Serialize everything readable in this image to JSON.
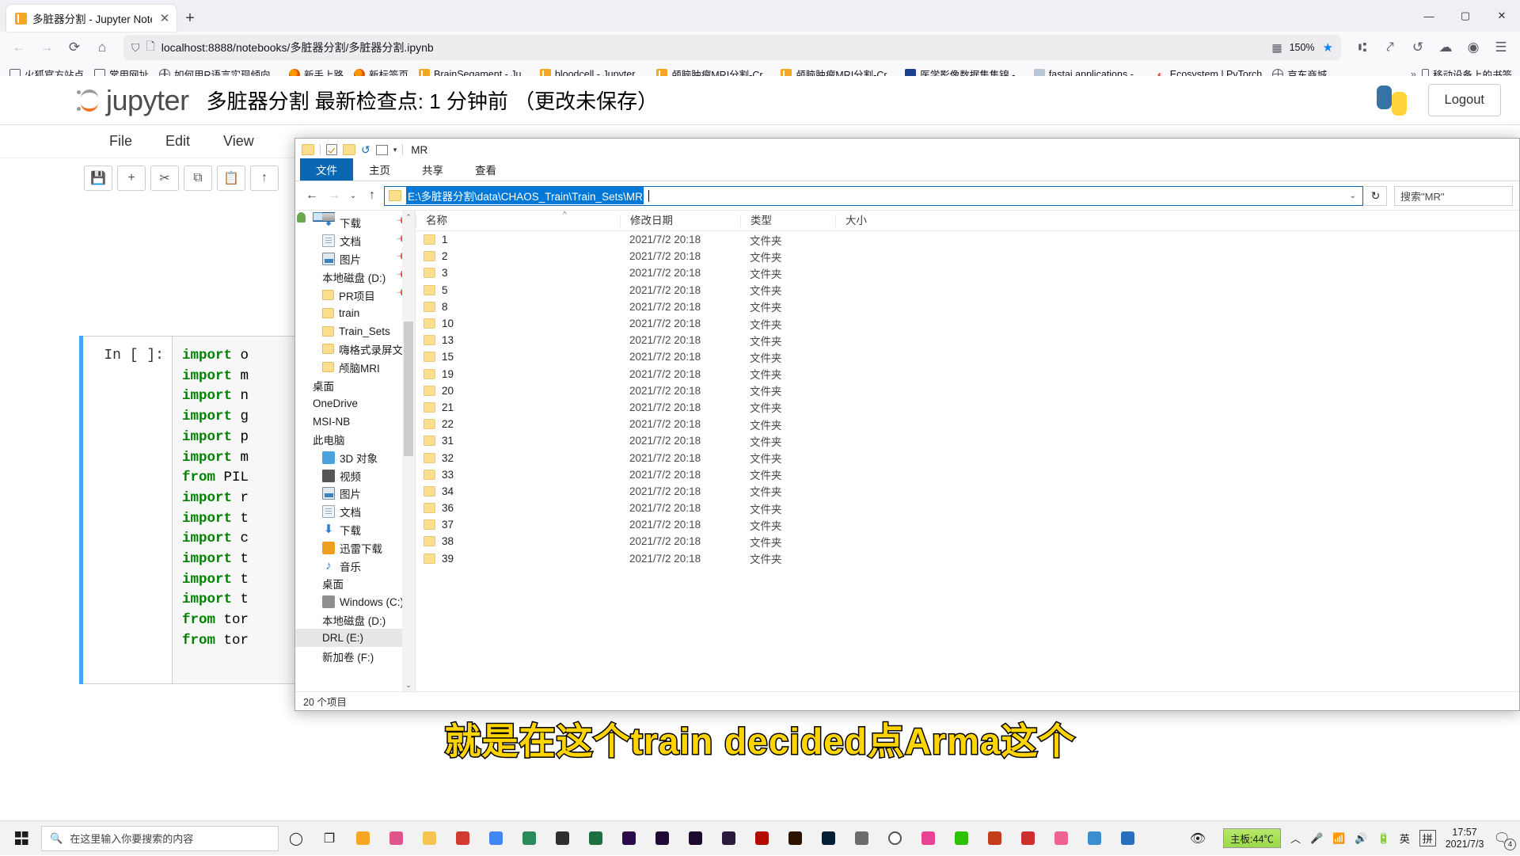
{
  "browser": {
    "tab": {
      "title": "多脏器分割 - Jupyter Notebo",
      "close": "✕",
      "favicon": "jupyter-book-icon"
    },
    "newtab_label": "+",
    "window_controls": {
      "minimize": "—",
      "maximize": "▢",
      "close": "✕"
    },
    "nav": {
      "back": "←",
      "forward": "→",
      "reload": "⟳",
      "home": "⌂"
    },
    "url": "localhost:8888/notebooks/多脏器分割/多脏器分割.ipynb",
    "zoom": "150%",
    "bookmarks": [
      {
        "label": "火狐官方站点",
        "icon": "folder-icon"
      },
      {
        "label": "常用网址",
        "icon": "folder-icon"
      },
      {
        "label": "如何用R语言实现倾向...",
        "icon": "globe-icon"
      },
      {
        "label": "新手上路",
        "icon": "firefox-icon"
      },
      {
        "label": "新标签页",
        "icon": "firefox-icon"
      },
      {
        "label": "BrainSegament - Ju...",
        "icon": "jupyter-icon"
      },
      {
        "label": "bloodcell - Jupyter ...",
        "icon": "jupyter-icon"
      },
      {
        "label": "颅脑肿瘤MRI分割-Cr...",
        "icon": "jupyter-icon"
      },
      {
        "label": "颅脑肿瘤MRI分割-Cr...",
        "icon": "jupyter-icon"
      },
      {
        "label": "医学影像数据集集锦 -...",
        "icon": "blue-square-icon"
      },
      {
        "label": "fastai applications - ...",
        "icon": "fastai-icon"
      },
      {
        "label": "Ecosystem | PyTorch",
        "icon": "pytorch-icon"
      },
      {
        "label": "京东商城",
        "icon": "globe-icon"
      }
    ],
    "bookmarks_overflow": "»",
    "mobile_bookmarks": "移动设备上的书签"
  },
  "jupyter": {
    "logo_text": "jupyter",
    "title": "多脏器分割 最新检查点: 1 分钟前 （更改未保存）",
    "logout_label": "Logout",
    "menus": [
      "File",
      "Edit",
      "View"
    ],
    "toolbar_icons": [
      "save-icon",
      "add-cell-icon",
      "cut-icon",
      "copy-icon",
      "paste-icon",
      "move-up-icon"
    ],
    "cell": {
      "prompt": "In [ ]:",
      "code_lines": [
        {
          "kw": "import",
          "rest": " o"
        },
        {
          "kw": "import",
          "rest": " m"
        },
        {
          "kw": "import",
          "rest": " n"
        },
        {
          "kw": "import",
          "rest": " g"
        },
        {
          "kw": "import",
          "rest": " p"
        },
        {
          "kw": "import",
          "rest": " m"
        },
        {
          "kw": "from",
          "rest": " PIL"
        },
        {
          "kw": "import",
          "rest": " r"
        },
        {
          "kw": "import",
          "rest": " t"
        },
        {
          "kw": "import",
          "rest": " c"
        },
        {
          "kw": "import",
          "rest": " t"
        },
        {
          "kw": "import",
          "rest": " t"
        },
        {
          "kw": "import",
          "rest": " t"
        },
        {
          "kw": "from",
          "rest": " tor"
        },
        {
          "kw": "from",
          "rest": " tor"
        }
      ]
    }
  },
  "explorer": {
    "quick_access_title": "MR",
    "ribbon_tabs": [
      "文件",
      "主页",
      "共享",
      "查看"
    ],
    "ribbon_active_index": 0,
    "address": "E:\\多脏器分割\\data\\CHAOS_Train\\Train_Sets\\MR",
    "address_dropdown": "⌄",
    "refresh": "↻",
    "search_placeholder": "搜索\"MR\"",
    "nav_items": [
      {
        "label": "下载",
        "icon": "download-icon",
        "pinned": true,
        "indent": 1
      },
      {
        "label": "文档",
        "icon": "documents-icon",
        "pinned": true,
        "indent": 1
      },
      {
        "label": "图片",
        "icon": "pictures-icon",
        "pinned": true,
        "indent": 1
      },
      {
        "label": "本地磁盘 (D:)",
        "icon": "disk-icon",
        "pinned": true,
        "indent": 1
      },
      {
        "label": "PR项目",
        "icon": "folder-icon",
        "pinned": true,
        "indent": 1
      },
      {
        "label": "train",
        "icon": "folder-icon",
        "pinned": false,
        "indent": 1
      },
      {
        "label": "Train_Sets",
        "icon": "folder-icon",
        "pinned": false,
        "indent": 1
      },
      {
        "label": "嗨格式录屏文件",
        "icon": "folder-icon",
        "pinned": false,
        "indent": 1
      },
      {
        "label": "颅脑MRI",
        "icon": "folder-icon",
        "pinned": false,
        "indent": 1
      },
      {
        "label": "桌面",
        "icon": "desktop-icon",
        "pinned": false,
        "indent": 0
      },
      {
        "label": "OneDrive",
        "icon": "onedrive-icon",
        "pinned": false,
        "indent": 0
      },
      {
        "label": "MSI-NB",
        "icon": "user-icon",
        "pinned": false,
        "indent": 0
      },
      {
        "label": "此电脑",
        "icon": "this-pc-icon",
        "pinned": false,
        "indent": 0
      },
      {
        "label": "3D 对象",
        "icon": "3d-objects-icon",
        "pinned": false,
        "indent": 1
      },
      {
        "label": "视频",
        "icon": "videos-icon",
        "pinned": false,
        "indent": 1
      },
      {
        "label": "图片",
        "icon": "pictures-icon",
        "pinned": false,
        "indent": 1
      },
      {
        "label": "文档",
        "icon": "documents-icon",
        "pinned": false,
        "indent": 1
      },
      {
        "label": "下载",
        "icon": "download-icon",
        "pinned": false,
        "indent": 1
      },
      {
        "label": "迅雷下载",
        "icon": "thunder-icon",
        "pinned": false,
        "indent": 1
      },
      {
        "label": "音乐",
        "icon": "music-icon",
        "pinned": false,
        "indent": 1
      },
      {
        "label": "桌面",
        "icon": "desktop-icon",
        "pinned": false,
        "indent": 1
      },
      {
        "label": "Windows (C:)",
        "icon": "windows-disk-icon",
        "pinned": false,
        "indent": 1
      },
      {
        "label": "本地磁盘 (D:)",
        "icon": "disk-icon",
        "pinned": false,
        "indent": 1
      },
      {
        "label": "DRL (E:)",
        "icon": "disk-icon",
        "pinned": false,
        "indent": 1,
        "selected": true
      },
      {
        "label": "新加卷 (F:)",
        "icon": "disk-icon",
        "pinned": false,
        "indent": 1
      }
    ],
    "columns": [
      "名称",
      "修改日期",
      "类型",
      "大小"
    ],
    "sort_marker": "^",
    "rows": [
      {
        "name": "1",
        "date": "2021/7/2 20:18",
        "type": "文件夹",
        "size": ""
      },
      {
        "name": "2",
        "date": "2021/7/2 20:18",
        "type": "文件夹",
        "size": ""
      },
      {
        "name": "3",
        "date": "2021/7/2 20:18",
        "type": "文件夹",
        "size": ""
      },
      {
        "name": "5",
        "date": "2021/7/2 20:18",
        "type": "文件夹",
        "size": ""
      },
      {
        "name": "8",
        "date": "2021/7/2 20:18",
        "type": "文件夹",
        "size": ""
      },
      {
        "name": "10",
        "date": "2021/7/2 20:18",
        "type": "文件夹",
        "size": ""
      },
      {
        "name": "13",
        "date": "2021/7/2 20:18",
        "type": "文件夹",
        "size": ""
      },
      {
        "name": "15",
        "date": "2021/7/2 20:18",
        "type": "文件夹",
        "size": ""
      },
      {
        "name": "19",
        "date": "2021/7/2 20:18",
        "type": "文件夹",
        "size": ""
      },
      {
        "name": "20",
        "date": "2021/7/2 20:18",
        "type": "文件夹",
        "size": ""
      },
      {
        "name": "21",
        "date": "2021/7/2 20:18",
        "type": "文件夹",
        "size": ""
      },
      {
        "name": "22",
        "date": "2021/7/2 20:18",
        "type": "文件夹",
        "size": ""
      },
      {
        "name": "31",
        "date": "2021/7/2 20:18",
        "type": "文件夹",
        "size": ""
      },
      {
        "name": "32",
        "date": "2021/7/2 20:18",
        "type": "文件夹",
        "size": ""
      },
      {
        "name": "33",
        "date": "2021/7/2 20:18",
        "type": "文件夹",
        "size": ""
      },
      {
        "name": "34",
        "date": "2021/7/2 20:18",
        "type": "文件夹",
        "size": ""
      },
      {
        "name": "36",
        "date": "2021/7/2 20:18",
        "type": "文件夹",
        "size": ""
      },
      {
        "name": "37",
        "date": "2021/7/2 20:18",
        "type": "文件夹",
        "size": ""
      },
      {
        "name": "38",
        "date": "2021/7/2 20:18",
        "type": "文件夹",
        "size": ""
      },
      {
        "name": "39",
        "date": "2021/7/2 20:18",
        "type": "文件夹",
        "size": ""
      }
    ],
    "status": "20 个项目"
  },
  "subtitle": "就是在这个train decided点Arma这个",
  "taskbar": {
    "search_placeholder": "在这里输入你要搜索的内容",
    "cortana": "◯",
    "task_view": "❐",
    "apps": [
      {
        "name": "app-explorer-orange",
        "color": "#f5a623"
      },
      {
        "name": "app-firefox",
        "color": "#e0568c"
      },
      {
        "name": "app-file-explorer",
        "color": "#f6c451"
      },
      {
        "name": "app-pdf-red",
        "color": "#d13b2e"
      },
      {
        "name": "app-chrome",
        "color": "#4285f4"
      },
      {
        "name": "app-camtasia",
        "color": "#2b8a5a"
      },
      {
        "name": "app-terminal",
        "color": "#2f2f2f"
      },
      {
        "name": "app-excel",
        "color": "#1d6f42"
      },
      {
        "name": "app-premiere",
        "color": "#2a0a4a"
      },
      {
        "name": "app-aftereffects",
        "color": "#1f0a36"
      },
      {
        "name": "app-media-encoder",
        "color": "#1b0a2e"
      },
      {
        "name": "app-animate",
        "color": "#2a1a3c"
      },
      {
        "name": "app-acrobat",
        "color": "#b30b00"
      },
      {
        "name": "app-illustrator",
        "color": "#2b1300"
      },
      {
        "name": "app-photoshop",
        "color": "#001e36"
      },
      {
        "name": "app-jupyter",
        "color": "#6b6b6b"
      },
      {
        "name": "app-circle",
        "color": "#ffffff"
      },
      {
        "name": "app-colorful",
        "color": "#e84393"
      },
      {
        "name": "app-wechat",
        "color": "#2dc100"
      },
      {
        "name": "app-powerpoint",
        "color": "#c43e1c"
      },
      {
        "name": "app-camera",
        "color": "#cf2e2e"
      },
      {
        "name": "app-music",
        "color": "#f06292"
      },
      {
        "name": "app-window",
        "color": "#3a8fd0"
      },
      {
        "name": "app-notepad",
        "color": "#2a6fbd"
      }
    ],
    "tray": {
      "eye_icon": "eye-icon",
      "temperature": "主板:44℃",
      "chevron": "︿",
      "mic": "🎤",
      "wifi": "wifi-icon",
      "volume": "volume-icon",
      "battery": "battery-icon",
      "ime_lang": "英",
      "ime_mode": "拼",
      "time": "17:57",
      "date": "2021/7/3",
      "notification_count": "4"
    }
  }
}
